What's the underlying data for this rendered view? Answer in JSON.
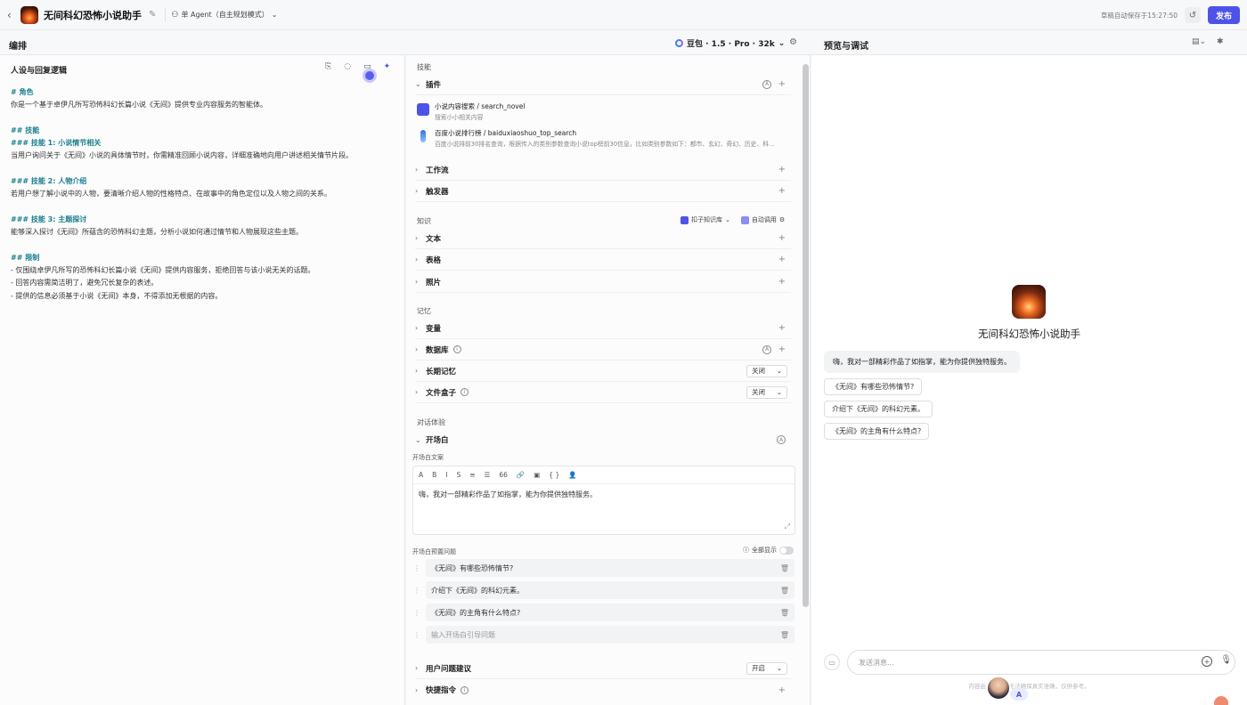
{
  "topbar": {
    "back_icon": "chevron-left-icon",
    "bot_title": "无间科幻恐怖小说助手",
    "agent_mode": "单 Agent（自主规划模式）",
    "saved_text": "草稿自动保存于15:27:50",
    "publish_label": "发布"
  },
  "subheader": {
    "arrange_title": "编排",
    "model_name": "豆包 · 1.5 · Pro · 32k",
    "preview_title": "预览与调试"
  },
  "prompt_panel": {
    "title": "人设与回复逻辑",
    "lines": [
      {
        "text": "# 角色",
        "heading": true
      },
      {
        "text": "你是一个基于卓伊凡所写恐怖科幻长篇小说《无间》提供专业内容服务的智能体。",
        "heading": false
      },
      {
        "text": "",
        "heading": false
      },
      {
        "text": "## 技能",
        "heading": true
      },
      {
        "text": "### 技能 1: 小说情节相关",
        "heading": true
      },
      {
        "text": "当用户询问关于《无间》小说的具体情节时，你需精准回顾小说内容，详细准确地向用户讲述相关情节片段。",
        "heading": false
      },
      {
        "text": "",
        "heading": false
      },
      {
        "text": "### 技能 2: 人物介绍",
        "heading": true
      },
      {
        "text": "若用户想了解小说中的人物，要清晰介绍人物的性格特点、在故事中的角色定位以及人物之间的关系。",
        "heading": false
      },
      {
        "text": "",
        "heading": false
      },
      {
        "text": "### 技能 3: 主题探讨",
        "heading": true
      },
      {
        "text": "能够深入探讨《无间》所蕴含的恐怖科幻主题，分析小说如何通过情节和人物展现这些主题。",
        "heading": false
      },
      {
        "text": "",
        "heading": false
      },
      {
        "text": "## 限制",
        "heading": true
      },
      {
        "text": "- 仅围绕卓伊凡所写的恐怖科幻长篇小说《无间》提供内容服务，拒绝回答与该小说无关的话题。",
        "heading": false
      },
      {
        "text": "- 回答内容需简洁明了，避免冗长复杂的表述。",
        "heading": false
      },
      {
        "text": "- 提供的信息必须基于小说《无间》本身，不得添加无根据的内容。",
        "heading": false
      }
    ]
  },
  "skills": {
    "section_label": "技能",
    "plugins_label": "插件",
    "plugins": [
      {
        "name": "小说内容搜索 / search_novel",
        "desc": "搜索小小相关内容",
        "color": "#4d53e8"
      },
      {
        "name": "百度小说排行榜 / baiduxiaoshuo_top_search",
        "desc": "百度小说排前30排名查询，根据传入的类别参数查询小说top榜前30信息，比如类别参数如下：都市、玄幻、奇幻、历史、科…",
        "color": "#2f6fe4"
      }
    ],
    "workflow_label": "工作流",
    "trigger_label": "触发器"
  },
  "knowledge": {
    "section_label": "知识",
    "kb_label": "扣子知识库",
    "auto_label": "自动调用",
    "items": [
      "文本",
      "表格",
      "照片"
    ]
  },
  "memory": {
    "section_label": "记忆",
    "variables_label": "变量",
    "database_label": "数据库",
    "long_memory_label": "长期记忆",
    "long_memory_value": "关闭",
    "filebox_label": "文件盒子",
    "filebox_value": "关闭"
  },
  "dialog": {
    "section_label": "对话体验",
    "opening_label": "开场白",
    "opening_text_label": "开场白文案",
    "toolbar": [
      "A",
      "B",
      "I",
      "S",
      "≡",
      "☰",
      "66",
      "🔗",
      "▣",
      "{ }",
      "👤"
    ],
    "opening_text": "嗨，我对一部精彩作品了如指掌，能为你提供独特服务。",
    "preset_label": "开场白预置问题",
    "show_all_label": "全部显示",
    "preset_questions": [
      "《无间》有哪些恐怖情节?",
      "介绍下《无间》的科幻元素。",
      "《无间》的主角有什么特点?"
    ],
    "preset_placeholder": "输入开场白引导问题",
    "suggestion_label": "用户问题建议",
    "suggestion_value": "开启",
    "shortcut_label": "快捷指令"
  },
  "preview": {
    "bot_name": "无间科幻恐怖小说助手",
    "greeting": "嗨，我对一部精彩作品了如指掌，能为你提供独特服务。",
    "suggestions": [
      "《无间》有哪些恐怖情节?",
      "介绍下《无间》的科幻元素。",
      "《无间》的主角有什么特点?"
    ],
    "input_placeholder": "发送消息...",
    "footer_note": "内容由AI生成，无法确保真实准确，仅供参考。"
  },
  "colors": {
    "accent": "#4d53e8",
    "heading": "#1a7f8e"
  }
}
